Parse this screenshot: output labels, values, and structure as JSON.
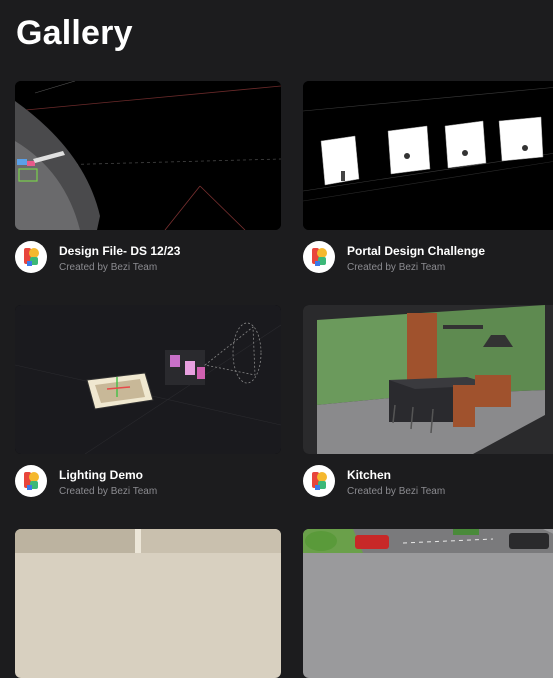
{
  "page": {
    "title": "Gallery"
  },
  "cards": [
    {
      "title": "Design File- DS 12/23",
      "author": "Created by Bezi Team",
      "thumbnail_icon": "design-file-scene"
    },
    {
      "title": "Portal Design Challenge",
      "author": "Created by Bezi Team",
      "thumbnail_icon": "portal-cubes-scene"
    },
    {
      "title": "Lighting Demo",
      "author": "Created by Bezi Team",
      "thumbnail_icon": "lighting-scene"
    },
    {
      "title": "Kitchen",
      "author": "Created by Bezi Team",
      "thumbnail_icon": "kitchen-scene"
    },
    {
      "title": "",
      "author": "",
      "thumbnail_icon": "room-scene"
    },
    {
      "title": "",
      "author": "",
      "thumbnail_icon": "city-street-scene"
    }
  ],
  "colors": {
    "background": "#1c1c1e",
    "subtitle": "#8b8b90",
    "kitchen_wall": "#6b9a5c",
    "logo_red": "#e8453c",
    "logo_yellow": "#f5b82e",
    "logo_green": "#3cb878",
    "logo_blue": "#3b7ae8"
  }
}
